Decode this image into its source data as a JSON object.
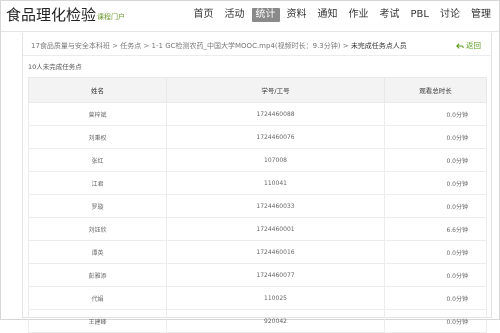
{
  "header": {
    "title": "食品理化检验",
    "subtitle": "课程门户",
    "nav": [
      "首页",
      "活动",
      "统计",
      "资料",
      "通知",
      "作业",
      "考试",
      "PBL",
      "讨论",
      "管理"
    ],
    "active_index": 2
  },
  "breadcrumb": {
    "path": "17食品质量与安全本科班 > 任务点 > 1-1 GC检测农药_中国大学MOOC.mp4(视频时长：9.3分钟) > ",
    "current": "未完成任务点人员"
  },
  "back_label": "返回",
  "summary": "10人未完成任务点",
  "table": {
    "headers": [
      "姓名",
      "学号/工号",
      "观看总时长"
    ],
    "rows": [
      [
        "曾梓斌",
        "1724460088",
        "0.0分钟"
      ],
      [
        "刘秉权",
        "1724460076",
        "0.0分钟"
      ],
      [
        "张红",
        "107008",
        "0.0分钟"
      ],
      [
        "江君",
        "110041",
        "0.0分钟"
      ],
      [
        "罗璇",
        "1724460033",
        "0.0分钟"
      ],
      [
        "刘钰欣",
        "1724460001",
        "6.6分钟"
      ],
      [
        "谭英",
        "1724460016",
        "0.0分钟"
      ],
      [
        "彭雅添",
        "1724460077",
        "0.0分钟"
      ],
      [
        "代娟",
        "110025",
        "0.0分钟"
      ],
      [
        "王建峰",
        "920042",
        "0.0分钟"
      ]
    ]
  },
  "colors": {
    "accent": "#5a9a1e",
    "nav_active": "#8a8a8a"
  }
}
